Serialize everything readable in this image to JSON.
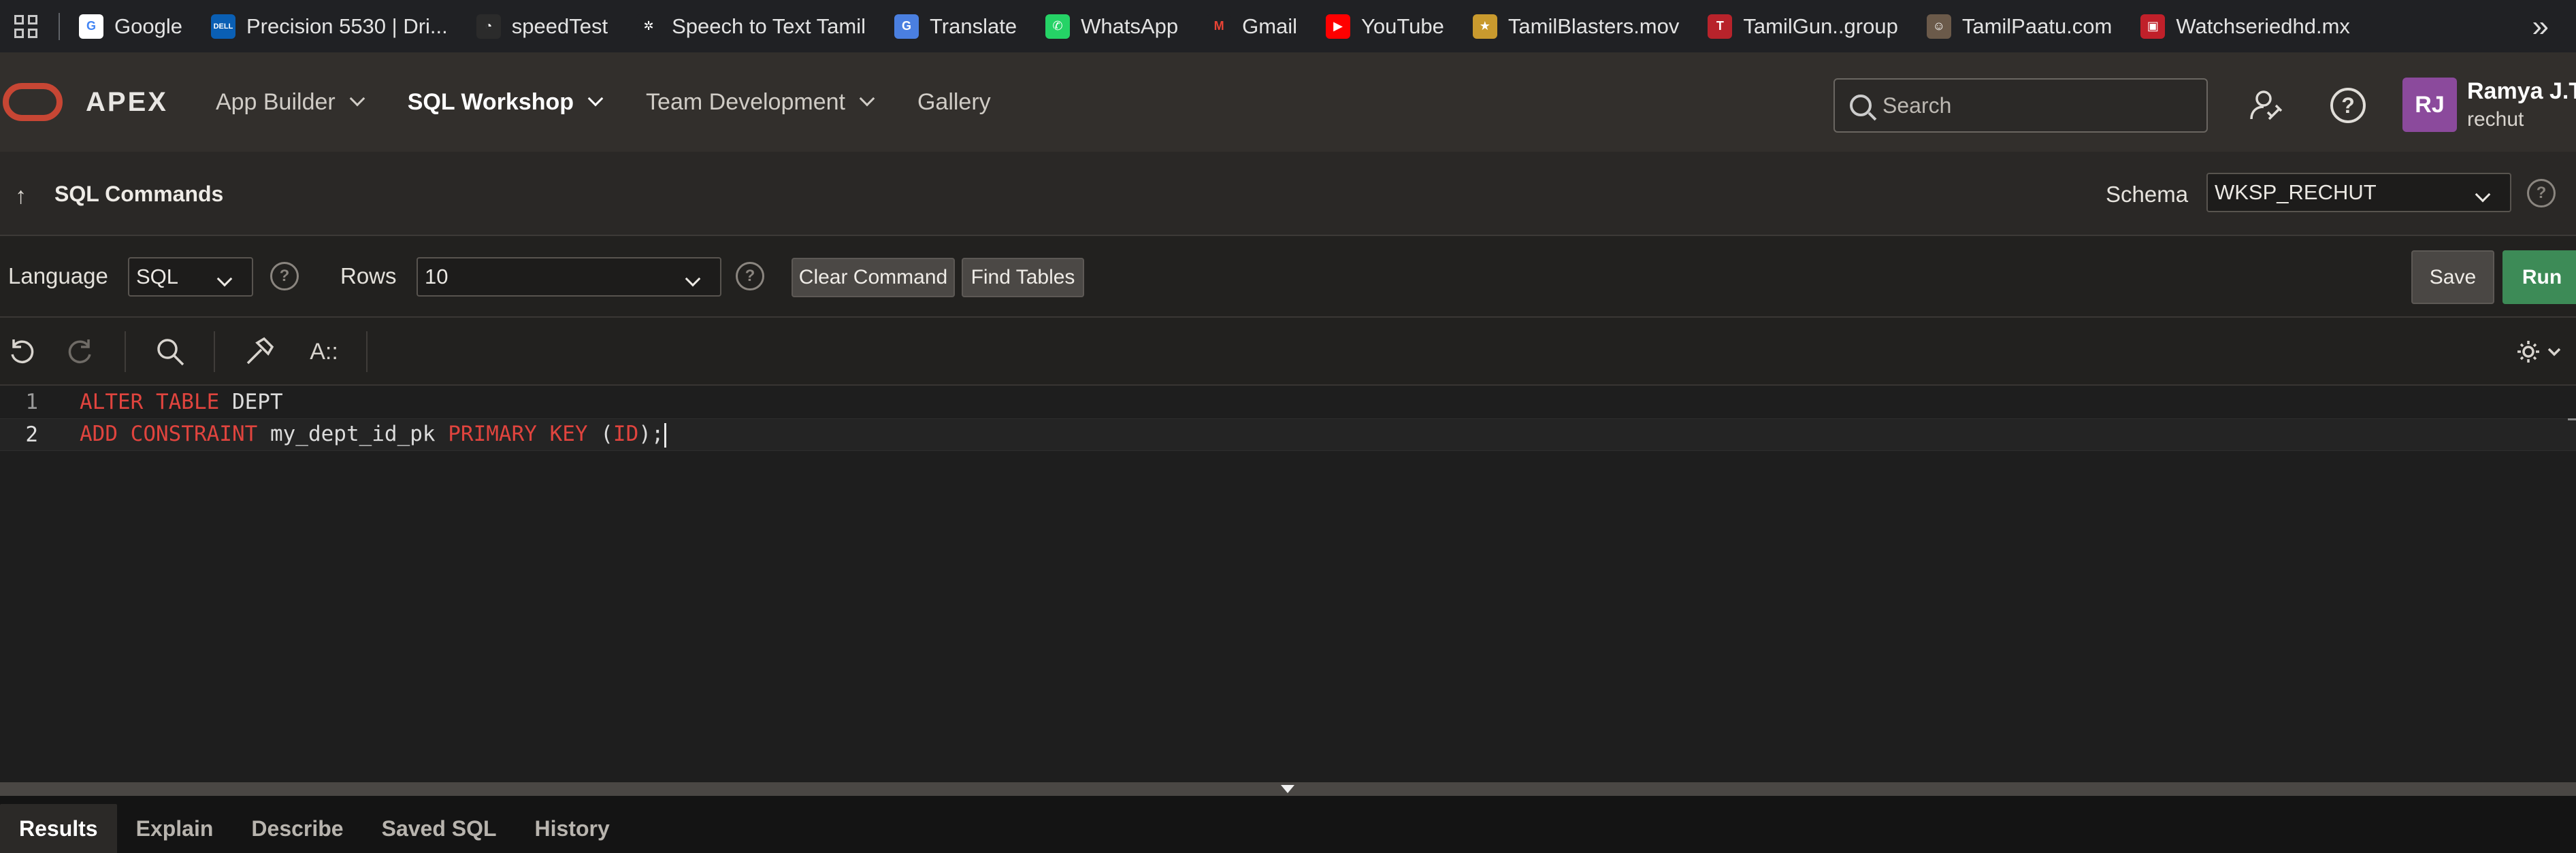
{
  "bookmarks": [
    {
      "label": "Google",
      "icon": "google-icon",
      "color": "#ffffff",
      "glyph": "G",
      "fg": "#4285f4"
    },
    {
      "label": "Precision 5530 | Dri...",
      "icon": "dell-icon",
      "color": "#0a5fb4",
      "glyph": "DELL",
      "fg": "#ffffff"
    },
    {
      "label": "speedTest",
      "icon": "speedometer-icon",
      "color": "#2b2b2b",
      "glyph": "◔",
      "fg": "#ffffff"
    },
    {
      "label": "Speech to Text Tamil",
      "icon": "joomla-icon",
      "color": "#202124",
      "glyph": "✲",
      "fg": "#ffffff"
    },
    {
      "label": "Translate",
      "icon": "google-translate-icon",
      "color": "#4a7fe0",
      "glyph": "G",
      "fg": "#ffffff"
    },
    {
      "label": "WhatsApp",
      "icon": "whatsapp-icon",
      "color": "#25d366",
      "glyph": "✆",
      "fg": "#ffffff"
    },
    {
      "label": "Gmail",
      "icon": "gmail-icon",
      "color": "#202124",
      "glyph": "M",
      "fg": "#ea4335"
    },
    {
      "label": "YouTube",
      "icon": "youtube-icon",
      "color": "#ff0000",
      "glyph": "▶",
      "fg": "#ffffff"
    },
    {
      "label": "TamilBlasters.mov",
      "icon": "tamilblasters-icon",
      "color": "#c99a2e",
      "glyph": "★",
      "fg": "#ffffff"
    },
    {
      "label": "TamilGun..group",
      "icon": "tamilgun-icon",
      "color": "#b8232b",
      "glyph": "T",
      "fg": "#ffffff"
    },
    {
      "label": "TamilPaatu.com",
      "icon": "tamilpaatu-icon",
      "color": "#6b5a4a",
      "glyph": "☺",
      "fg": "#ffffff"
    },
    {
      "label": "Watchseriedhd.mx",
      "icon": "watchseries-icon",
      "color": "#c0202a",
      "glyph": "▣",
      "fg": "#ffffff"
    }
  ],
  "header": {
    "brand": "APEX",
    "nav": [
      {
        "label": "App Builder",
        "has_menu": true,
        "active": false
      },
      {
        "label": "SQL Workshop",
        "has_menu": true,
        "active": true
      },
      {
        "label": "Team Development",
        "has_menu": true,
        "active": false
      },
      {
        "label": "Gallery",
        "has_menu": false,
        "active": false
      }
    ],
    "search_placeholder": "Search",
    "user_initials": "RJ",
    "user_name": "Ramya J.T",
    "user_workspace": "rechut"
  },
  "titlebar": {
    "title": "SQL Commands",
    "schema_label": "Schema",
    "schema_value": "WKSP_RECHUT"
  },
  "toolbar": {
    "language_label": "Language",
    "language_value": "SQL",
    "rows_label": "Rows",
    "rows_value": "10",
    "clear_label": "Clear Command",
    "find_label": "Find Tables",
    "save_label": "Save",
    "run_label": "Run"
  },
  "editor": {
    "lines": [
      {
        "number": "1",
        "kw1": "ALTER TABLE",
        "text1": " DEPT"
      },
      {
        "number": "2",
        "kw1": "ADD CONSTRAINT",
        "text1": " my_dept_id_pk ",
        "kw2": "PRIMARY KEY",
        "text2": " (",
        "kw3": "ID",
        "text3": ");"
      }
    ]
  },
  "results_tabs": [
    "Results",
    "Explain",
    "Describe",
    "Saved SQL",
    "History"
  ],
  "colors": {
    "run_button": "#3d8b57",
    "keyword": "#e0443e",
    "oracle_red": "#c74634",
    "avatar": "#8b4a9c"
  }
}
